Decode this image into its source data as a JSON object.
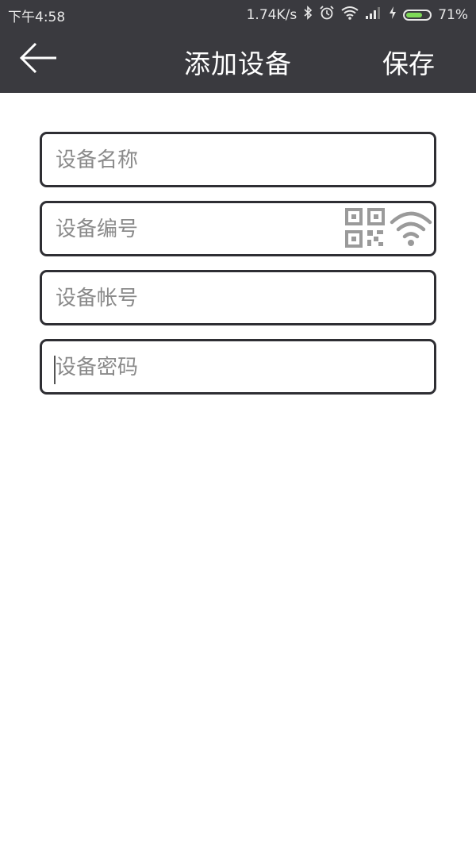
{
  "status": {
    "time": "下午4:58",
    "net_speed": "1.74K/s",
    "battery": "71%",
    "battery_level": 0.71,
    "icons": [
      "bluetooth-icon",
      "alarm-icon",
      "wifi-icon",
      "signal-icon",
      "charging-icon",
      "battery-icon"
    ]
  },
  "navbar": {
    "title": "添加设备",
    "save_label": "保存",
    "back_icon": "arrow-left-icon"
  },
  "form": {
    "name_placeholder": "设备名称",
    "id_placeholder": "设备编号",
    "account_placeholder": "设备帐号",
    "password_placeholder": "设备密码",
    "id_icons": [
      "qr-code-icon",
      "wifi-icon"
    ]
  },
  "colors": {
    "header_bg": "#3a3a3f",
    "field_border": "#2e2e33",
    "icon_gray": "#9a9a9a",
    "battery_green": "#7ed957"
  }
}
